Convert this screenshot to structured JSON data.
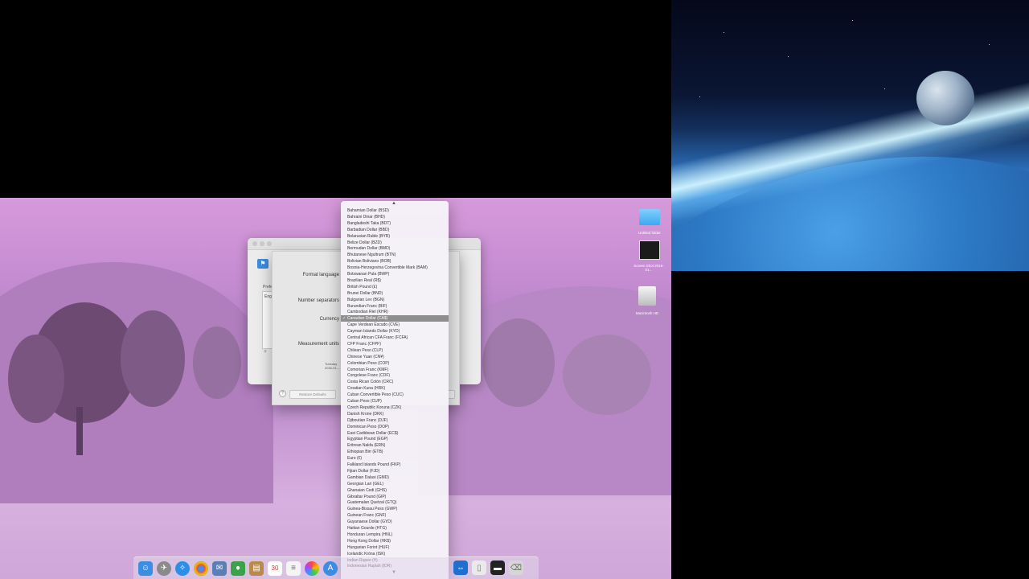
{
  "sheet": {
    "format_language_label": "Format language",
    "number_separators_label": "Number separators",
    "currency_label": "Currency",
    "measurement_units_label": "Measurement units",
    "date_line1": "Tuesday",
    "date_line2": "2016-01-...",
    "restore_defaults": "Restore Defaults",
    "help": "?"
  },
  "prefs_window": {
    "sidebar_label": "Prefe",
    "list_item": "Eng",
    "add": "+"
  },
  "currency_dropdown": {
    "selected_index": 17,
    "check": "✓",
    "scroll_up": "▲",
    "scroll_down": "▼",
    "items": [
      "Bahamian Dollar (BSD)",
      "Bahraini Dinar (BHD)",
      "Bangladeshi Taka (BDT)",
      "Barbadian Dollar (BBD)",
      "Belarusian Ruble (BYR)",
      "Belize Dollar (BZD)",
      "Bermudan Dollar (BMD)",
      "Bhutanese Ngultrum (BTN)",
      "Bolivian Boliviano (BOB)",
      "Bosnia-Herzegovina Convertible Mark (BAM)",
      "Botswanan Pula (BWP)",
      "Brazilian Real (R$)",
      "British Pound (£)",
      "Brunei Dollar (BND)",
      "Bulgarian Lev (BGN)",
      "Burundian Franc (BIF)",
      "Cambodian Riel (KHR)",
      "Canadian Dollar (CA$)",
      "Cape Verdean Escudo (CVE)",
      "Cayman Islands Dollar (KYD)",
      "Central African CFA Franc (FCFA)",
      "CFP Franc (CFPF)",
      "Chilean Peso (CLP)",
      "Chinese Yuan (CN¥)",
      "Colombian Peso (COP)",
      "Comorian Franc (KMF)",
      "Congolese Franc (CDF)",
      "Costa Rican Colón (CRC)",
      "Croatian Kuna (HRK)",
      "Cuban Convertible Peso (CUC)",
      "Cuban Peso (CUP)",
      "Czech Republic Koruna (CZK)",
      "Danish Krone (DKK)",
      "Djiboutian Franc (DJF)",
      "Dominican Peso (DOP)",
      "East Caribbean Dollar (EC$)",
      "Egyptian Pound (EGP)",
      "Eritrean Nakfa (ERN)",
      "Ethiopian Birr (ETB)",
      "Euro (€)",
      "Falkland Islands Pound (FKP)",
      "Fijian Dollar (FJD)",
      "Gambian Dalasi (GMD)",
      "Georgian Lari (GEL)",
      "Ghanaian Cedi (GHS)",
      "Gibraltar Pound (GIP)",
      "Guatemalan Quetzal (GTQ)",
      "Guinea-Bissau Peso (GWP)",
      "Guinean Franc (GNF)",
      "Guyanaese Dollar (GYD)",
      "Haitian Gourde (HTG)",
      "Honduran Lempira (HNL)",
      "Hong Kong Dollar (HK$)",
      "Hungarian Forint (HUF)",
      "Icelandic Króna (ISK)",
      "Indian Rupee (₹)",
      "Indonesian Rupiah (IDR)"
    ]
  },
  "desktop_icons": [
    {
      "label": "Untitled folder",
      "icon": "folder-icon"
    },
    {
      "label": "Screen Shot 2016-01...",
      "icon": "document-icon"
    },
    {
      "label": "Macintosh HD",
      "icon": "hard-drive-icon"
    }
  ],
  "dock": {
    "calendar_day": "30"
  },
  "colors": {
    "selection": "#8e8e8e",
    "accent_blue": "#3b8be0"
  }
}
